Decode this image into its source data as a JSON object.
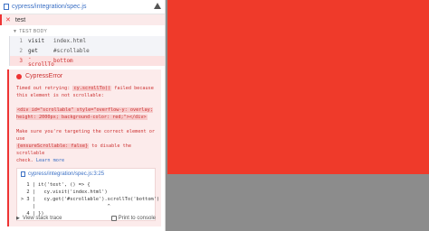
{
  "reporter": {
    "spec_path": "cypress/integration/spec.js",
    "test_title": "test",
    "body_label": "TEST BODY",
    "commands": [
      {
        "num": "1",
        "name": "visit",
        "message": "index.html"
      },
      {
        "num": "2",
        "name": "get",
        "message": "#scrollable"
      },
      {
        "num": "3",
        "name": "-scrollTo",
        "message": "bottom"
      }
    ],
    "error": {
      "title": "CypressError",
      "message_parts": [
        "Timed out retrying: ",
        "cy.scrollTo()",
        " failed because\nthis element is not scrollable:\n\n",
        "<div id=\"scrollable\" style=\"overflow-y: overlay;\nheight: 2000px; background-color: red;\"></div>",
        "\n\nMake sure you're targeting the correct element or use\n",
        "{ensureScrollable: false}",
        " to disable the scrollable\ncheck. "
      ],
      "learn_more": "Learn more",
      "frame_file": "cypress/integration/spec.js:3:25",
      "frame_lines": [
        {
          "text": "  1 | it('test', () => {"
        },
        {
          "text": "  2 |   cy.visit('index.html')"
        },
        {
          "text": "> 3 |   cy.get('#scrollable').scrollTo('bottom')"
        },
        {
          "text": "    |                         ^"
        },
        {
          "text": "  4 | })"
        }
      ],
      "stack_label": "View stack trace",
      "print_label": "Print to console"
    }
  },
  "aut": {
    "element_color": "#ef3a2a",
    "background_color": "#8c8c8c"
  }
}
